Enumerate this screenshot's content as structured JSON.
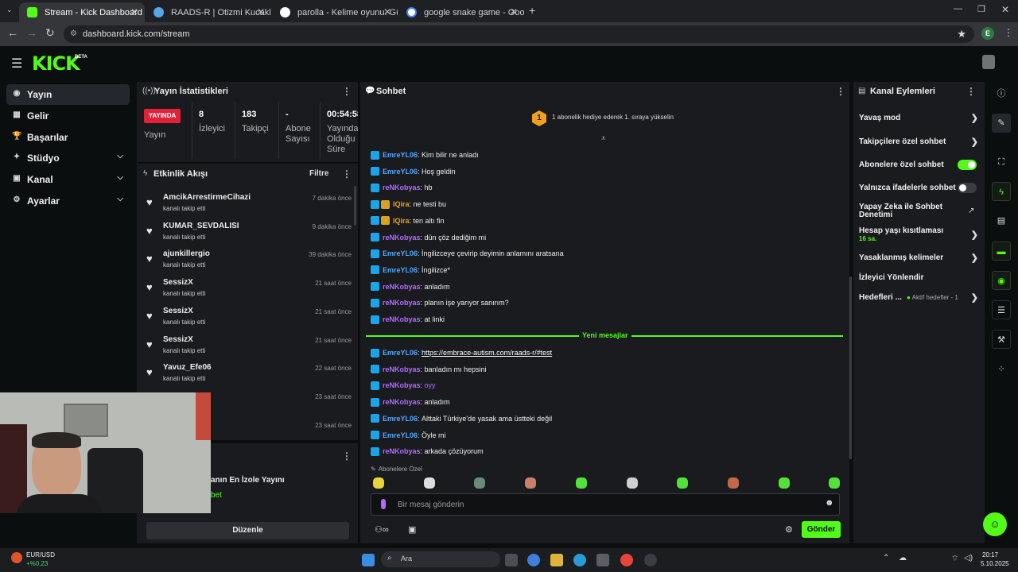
{
  "browser": {
    "tabs": [
      {
        "title": "Stream - Kick Dashboard",
        "active": true
      },
      {
        "title": "RAADS-R | Otizmi Kucaklayın"
      },
      {
        "title": "parolla - Kelime oyunu. Günlük"
      },
      {
        "title": "google snake game - Google'da"
      }
    ],
    "url": "dashboard.kick.com/stream"
  },
  "app": {
    "logo": "KICK",
    "beta": "BETA"
  },
  "sidebar": {
    "items": [
      {
        "label": "Yayın",
        "icon": "broadcast-icon",
        "selected": true
      },
      {
        "label": "Gelir",
        "icon": "dollar-icon"
      },
      {
        "label": "Başarılar",
        "icon": "trophy-icon"
      },
      {
        "label": "Stüdyo",
        "icon": "studio-icon"
      },
      {
        "label": "Kanal",
        "icon": "channel-icon"
      },
      {
        "label": "Ayarlar",
        "icon": "gear-icon"
      }
    ]
  },
  "stats": {
    "title": "Yayın İstatistikleri",
    "live_badge": "YAYINDA",
    "live_label": "Yayın",
    "viewers": {
      "value": "8",
      "label": "İzleyici"
    },
    "followers": {
      "value": "183",
      "label": "Takipçi"
    },
    "subs": {
      "value": "-",
      "label1": "Abone",
      "label2": "Sayısı"
    },
    "duration": {
      "value": "00:54:58",
      "label1": "Yayında",
      "label2": "Olduğu",
      "label3": "Süre"
    }
  },
  "activity": {
    "title": "Etkinlik Akışı",
    "filter": "Filtre",
    "items": [
      {
        "name": "AmcikArrestirmeCihazi",
        "sub": "kanalı takip etti",
        "time": "7 dakika önce"
      },
      {
        "name": "KUMAR_SEVDALISI",
        "sub": "kanalı takip etti",
        "time": "9 dakika önce"
      },
      {
        "name": "ajunkillergio",
        "sub": "kanalı takip etti",
        "time": "39 dakika önce"
      },
      {
        "name": "SessizX",
        "sub": "kanalı takip etti",
        "time": "21 saat önce"
      },
      {
        "name": "SessizX",
        "sub": "kanalı takip etti",
        "time": "21 saat önce"
      },
      {
        "name": "SessizX",
        "sub": "kanalı takip etti",
        "time": "21 saat önce"
      },
      {
        "name": "Yavuz_Efe06",
        "sub": "kanalı takip etti",
        "time": "22 saat önce"
      },
      {
        "name": "",
        "sub": "",
        "time": "23 saat önce"
      },
      {
        "name": "",
        "sub": "",
        "time": "23 saat önce"
      }
    ]
  },
  "lower_panel": {
    "title_fragment": "anın En İzole Yayını",
    "link_fragment": "bet",
    "edit_button": "Düzenle"
  },
  "chat": {
    "title": "Sohbet",
    "goal_number": "1",
    "goal_text": "1 abonelik hediye ederek 1. sıraya yükselin",
    "new_messages": "Yeni mesajlar",
    "messages_before": [
      {
        "user": "EmreYL06",
        "color": "#53a9ff",
        "badge": "blue",
        "text": "Kim bilir ne anladı"
      },
      {
        "user": "EmreYL06",
        "color": "#53a9ff",
        "badge": "blue",
        "text": "Hoş geldin"
      },
      {
        "user": "reNKobyas",
        "color": "#b16bff",
        "badge": "blue",
        "text": "hb"
      },
      {
        "user": "lQira",
        "color": "#e8a521",
        "badge": "gold",
        "text": "ne testi bu"
      },
      {
        "user": "lQira",
        "color": "#e8a521",
        "badge": "gold",
        "text": "ten altı fin"
      },
      {
        "user": "reNKobyas",
        "color": "#b16bff",
        "badge": "blue",
        "text": "dün çöz dediğim mi"
      },
      {
        "user": "EmreYL06",
        "color": "#53a9ff",
        "badge": "blue",
        "text": "İngilizceye çevirip deyimin anlamını aratsana"
      },
      {
        "user": "EmreYL06",
        "color": "#53a9ff",
        "badge": "blue",
        "text": "İngilizce*"
      },
      {
        "user": "reNKobyas",
        "color": "#b16bff",
        "badge": "blue",
        "text": "anladım"
      },
      {
        "user": "reNKobyas",
        "color": "#b16bff",
        "badge": "blue",
        "text": "planın işe yarıyor sanırım?"
      },
      {
        "user": "reNKobyas",
        "color": "#b16bff",
        "badge": "blue",
        "text": "at linki"
      }
    ],
    "messages_after": [
      {
        "user": "EmreYL06",
        "color": "#53a9ff",
        "badge": "blue",
        "text": "https://embrace-autism.com/raads-r/#test",
        "link": true
      },
      {
        "user": "reNKobyas",
        "color": "#b16bff",
        "badge": "blue",
        "text": "banladın mı hepsini"
      },
      {
        "user": "reNKobyas",
        "color": "#b16bff",
        "badge": "blue",
        "text": "oyy",
        "text_color": "#b16bff"
      },
      {
        "user": "reNKobyas",
        "color": "#b16bff",
        "badge": "blue",
        "text": "anladım"
      },
      {
        "user": "EmreYL06",
        "color": "#53a9ff",
        "badge": "blue",
        "text": "Alttaki Türkiye'de yasak ama üstteki değil"
      },
      {
        "user": "EmreYL06",
        "color": "#53a9ff",
        "badge": "blue",
        "text": "Öyle mi"
      },
      {
        "user": "reNKobyas",
        "color": "#b16bff",
        "badge": "blue",
        "text": "arkada çözüyorum"
      }
    ],
    "subscriber_emotes_label": "Abonelere Özel",
    "input_placeholder": "Bir mesaj gönderin",
    "send_button": "Gönder"
  },
  "channel_actions": {
    "title": "Kanal Eylemleri",
    "slow_mode": "Yavaş mod",
    "followers_chat": "Takipçilere özel sohbet",
    "subscribers_chat": "Abonelere özel sohbet",
    "subscribers_chat_on": true,
    "emote_chat": "Yalnızca ifadelerle sohbet",
    "emote_chat_on": false,
    "ai_moderation": "Yapay Zeka ile Sohbet Denetimi",
    "account_age": "Hesap yaşı kısıtlaması",
    "account_age_value": "16 sa.",
    "banned_words": "Yasaklanmış kelimeler",
    "viewer_redirect": "İzleyici Yönlendir",
    "goals": "Hedefleri ...",
    "goals_status": "Aktif hedefler - 1"
  },
  "taskbar": {
    "ticker_symbol": "EUR/USD",
    "ticker_change": "+%0,23",
    "search": "Ara",
    "time": "20:17",
    "date": "5.10.2025"
  },
  "colors": {
    "accent": "#53fc18",
    "live": "#e3203a",
    "panel": "#191b1f",
    "bg": "#0b0e0f"
  }
}
